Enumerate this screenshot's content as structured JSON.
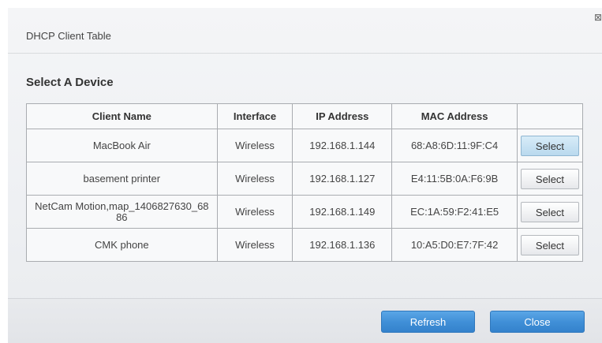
{
  "dialog": {
    "title": "DHCP Client Table",
    "close_glyph": "⊠"
  },
  "section": {
    "title": "Select A Device"
  },
  "table": {
    "headers": [
      "Client Name",
      "Interface",
      "IP Address",
      "MAC Address",
      ""
    ],
    "rows": [
      {
        "name": "MacBook Air",
        "interface": "Wireless",
        "ip": "192.168.1.144",
        "mac": "68:A8:6D:11:9F:C4",
        "action": "Select"
      },
      {
        "name": "basement printer",
        "interface": "Wireless",
        "ip": "192.168.1.127",
        "mac": "E4:11:5B:0A:F6:9B",
        "action": "Select"
      },
      {
        "name": "NetCam Motion,map_1406827630_68 86",
        "interface": "Wireless",
        "ip": "192.168.1.149",
        "mac": "EC:1A:59:F2:41:E5",
        "action": "Select"
      },
      {
        "name": "CMK phone",
        "interface": "Wireless",
        "ip": "192.168.1.136",
        "mac": "10:A5:D0:E7:7F:42",
        "action": "Select"
      }
    ]
  },
  "footer": {
    "refresh_label": "Refresh",
    "close_label": "Close"
  },
  "colors": {
    "primary_button": "#3f8ed6",
    "selected_row_button": "#b9d9ee"
  }
}
